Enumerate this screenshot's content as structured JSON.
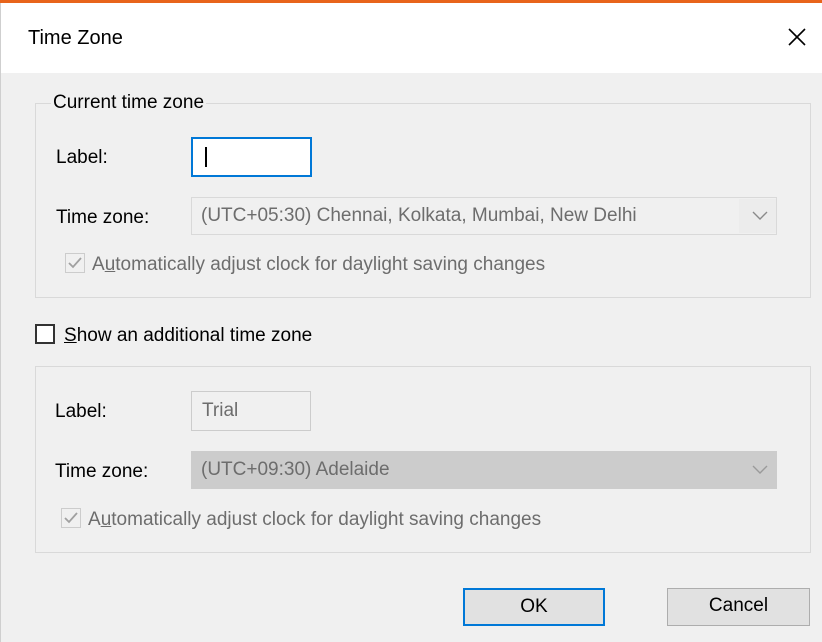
{
  "window": {
    "title": "Time Zone",
    "accent_color": "#e8641b"
  },
  "current_zone": {
    "group_label": "Current time zone",
    "label_caption": "Label:",
    "label_value": "",
    "zone_caption": "Time zone:",
    "zone_value": "(UTC+05:30) Chennai, Kolkata, Mumbai, New Delhi",
    "dst_checkbox": {
      "label_prefix": "A",
      "label_ul": "u",
      "label_rest": "tomatically adjust clock for daylight saving changes",
      "checked": true,
      "enabled": false
    }
  },
  "additional_zone": {
    "toggle": {
      "label_ul": "S",
      "label_rest": "how an additional time zone",
      "checked": false
    },
    "label_caption": "Label:",
    "label_value": "Trial",
    "zone_caption": "Time zone:",
    "zone_value": "(UTC+09:30) Adelaide",
    "dst_checkbox": {
      "label_prefix": "A",
      "label_ul": "u",
      "label_rest": "tomatically adjust clock for daylight saving changes",
      "checked": true,
      "enabled": false
    }
  },
  "buttons": {
    "ok_label": "OK",
    "cancel_label": "Cancel"
  }
}
